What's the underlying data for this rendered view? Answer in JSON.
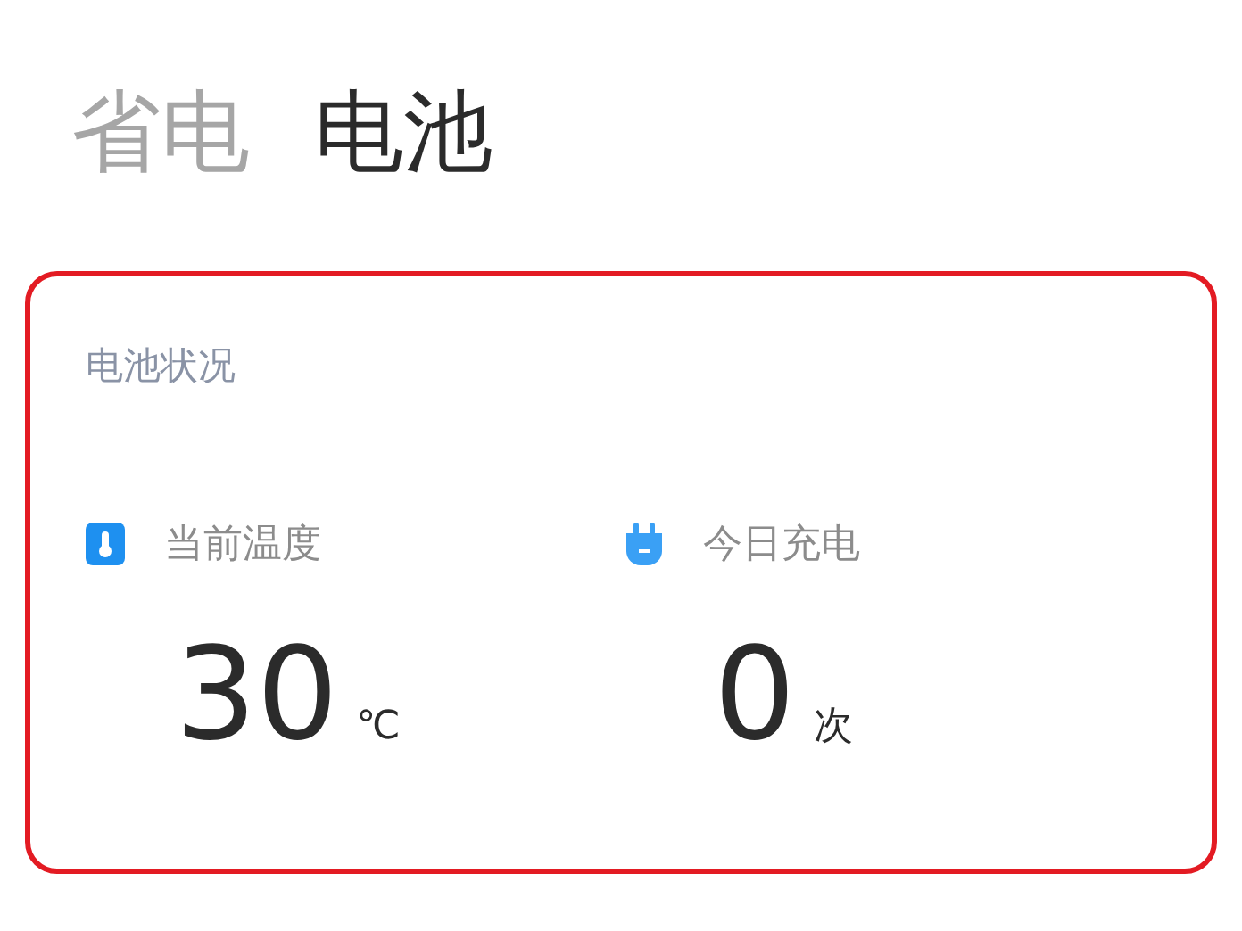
{
  "tabs": [
    {
      "label": "省电",
      "selected": false
    },
    {
      "label": "电池",
      "selected": true
    }
  ],
  "card": {
    "title": "电池状况",
    "highlighted": true,
    "stats": [
      {
        "kind": "temperature",
        "label": "当前温度",
        "value": "30",
        "unit": "℃"
      },
      {
        "kind": "charge",
        "label": "今日充电",
        "value": "0",
        "unit": "次"
      }
    ]
  }
}
